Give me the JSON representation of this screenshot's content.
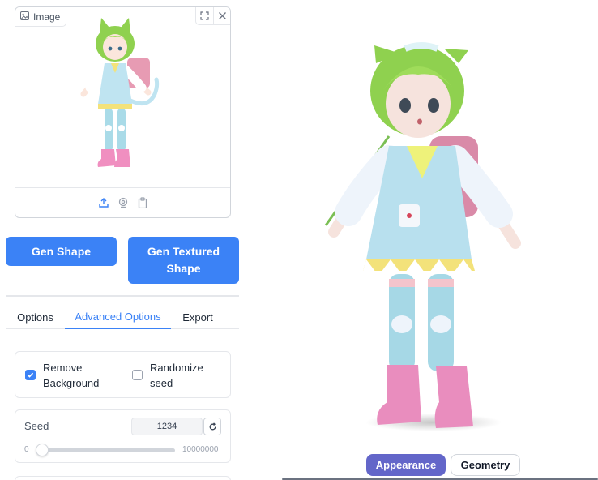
{
  "image_panel": {
    "label": "Image",
    "icons": [
      "image-icon",
      "fullscreen-icon",
      "close-icon",
      "upload-icon",
      "webcam-icon",
      "clipboard-icon"
    ]
  },
  "buttons": {
    "gen_shape": "Gen Shape",
    "gen_textured_shape": "Gen Textured Shape"
  },
  "tabs": [
    {
      "label": "Options",
      "active": false
    },
    {
      "label": "Advanced Options",
      "active": true
    },
    {
      "label": "Export",
      "active": false
    }
  ],
  "options": {
    "remove_background": {
      "label": "Remove Background",
      "checked": true
    },
    "randomize_seed": {
      "label": "Randomize seed",
      "checked": false
    }
  },
  "seed": {
    "label": "Seed",
    "value": "1234",
    "min": "0",
    "max": "10000000",
    "slider_fraction": 0.0001234
  },
  "viewer": {
    "modes": [
      {
        "label": "Appearance",
        "active": true
      },
      {
        "label": "Geometry",
        "active": false
      }
    ]
  },
  "colors": {
    "accent": "#3b82f6",
    "mode_active": "#6366c9"
  }
}
